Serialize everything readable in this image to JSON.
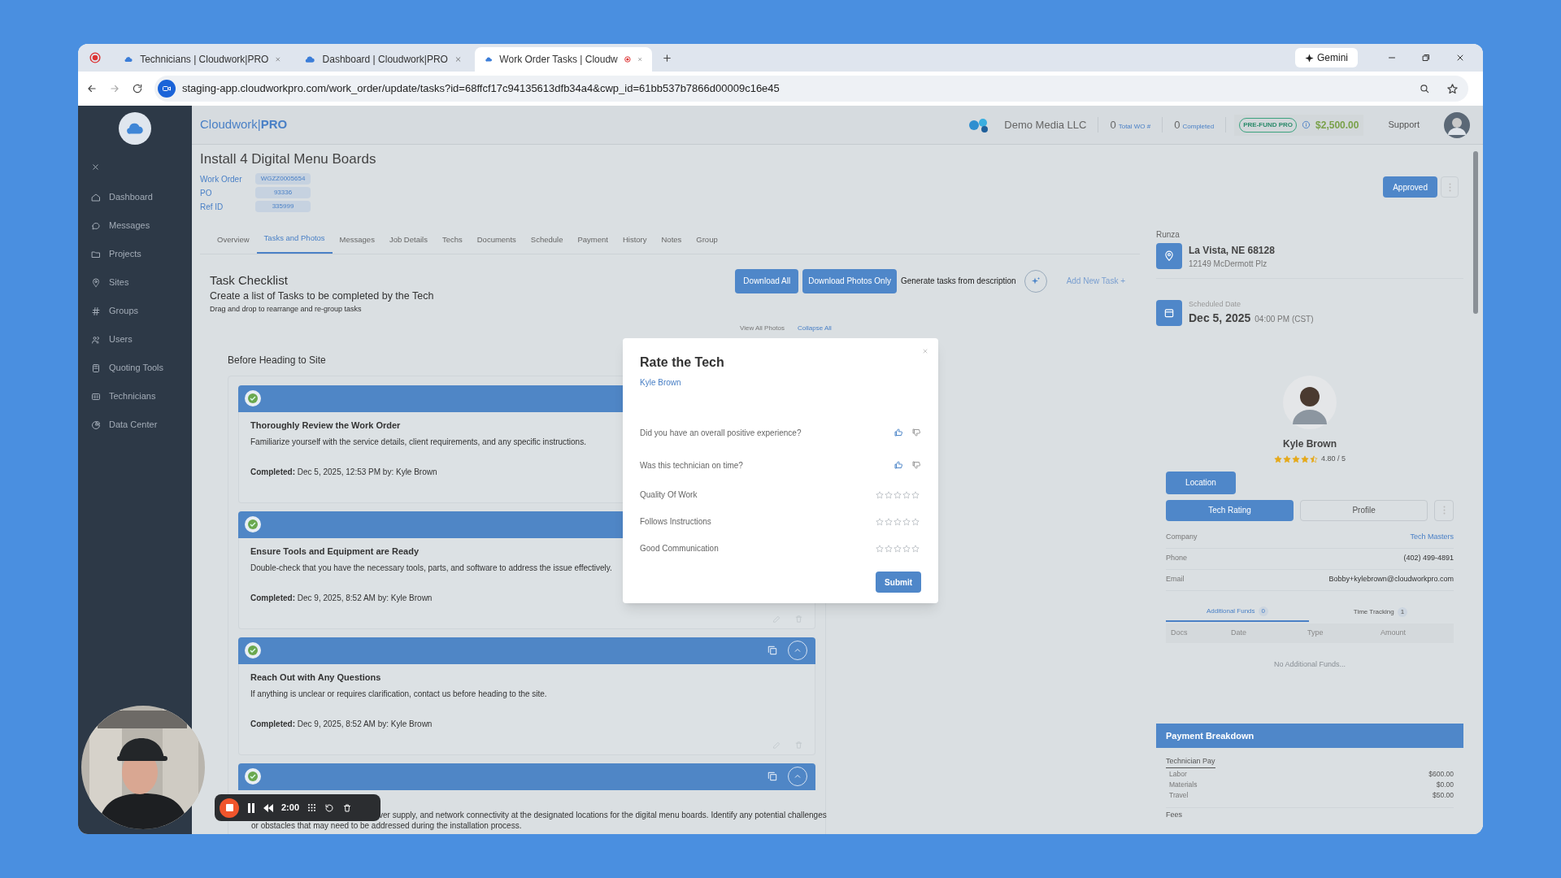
{
  "browser": {
    "tabs": [
      {
        "title": "Technicians | Cloudwork|PRO",
        "selected": false,
        "recording": false
      },
      {
        "title": "Dashboard | Cloudwork|PRO",
        "selected": false,
        "recording": false
      },
      {
        "title": "Work Order Tasks | Cloudw",
        "selected": true,
        "recording": true
      }
    ],
    "gemini": "Gemini",
    "url": "staging-app.cloudworkpro.com/work_order/update/tasks?id=68ffcf17c94135613dfb34a4&cwp_id=61bb537b7866d00009c16e45"
  },
  "sidebar": {
    "items": [
      "Dashboard",
      "Messages",
      "Projects",
      "Sites",
      "Groups",
      "Users",
      "Quoting Tools",
      "Technicians",
      "Data Center"
    ]
  },
  "header": {
    "brand": "Cloudwork|**PRO**",
    "company": "Demo Media LLC",
    "stats": [
      {
        "value": "0",
        "label": "Total WO #"
      },
      {
        "value": "0",
        "label": "Completed"
      }
    ],
    "badge": "PRE-FUND PRO",
    "balance": "$2,500.00",
    "support": "Support"
  },
  "work_order": {
    "title": "Install 4 Digital Menu Boards",
    "fields": [
      {
        "label": "Work Order",
        "value": "WGZZ0005654"
      },
      {
        "label": "PO",
        "value": "93336"
      },
      {
        "label": "Ref ID",
        "value": "335999"
      }
    ],
    "status": "Approved"
  },
  "tabs": [
    {
      "label": "Overview",
      "selected": false
    },
    {
      "label": "Tasks and Photos",
      "selected": true
    },
    {
      "label": "Messages",
      "selected": false
    },
    {
      "label": "Job Details",
      "selected": false
    },
    {
      "label": "Techs",
      "selected": false
    },
    {
      "label": "Documents",
      "selected": false
    },
    {
      "label": "Schedule",
      "selected": false
    },
    {
      "label": "Payment",
      "selected": false
    },
    {
      "label": "History",
      "selected": false
    },
    {
      "label": "Notes",
      "selected": false
    },
    {
      "label": "Group",
      "selected": false
    }
  ],
  "checklist": {
    "title": "Task Checklist",
    "subtitle": "Create a list of Tasks to be completed by the Tech",
    "hint": "Drag and drop to rearrange and re-group tasks",
    "actions": [
      "Download All",
      "Download Photos Only"
    ],
    "generate": "Generate tasks from description",
    "add": "Add New Task +",
    "links": [
      "View All Photos",
      "Collapse All"
    ],
    "group": "Before Heading to Site",
    "tasks": [
      {
        "kind": "full",
        "title": "Thoroughly Review the Work Order",
        "description": "Familiarize yourself with the service details, client requirements, and any specific instructions.",
        "completed_label": "Completed:",
        "completed": "Dec 5, 2025, 12:53 PM by: Kyle Brown"
      },
      {
        "kind": "full",
        "title": "Ensure Tools and Equipment are Ready",
        "description": "Double-check that you have the necessary tools, parts, and software to address the issue effectively.",
        "completed_label": "Completed:",
        "completed": "Dec 9, 2025, 8:52 AM by: Kyle Brown",
        "footer_tools": true
      },
      {
        "kind": "full",
        "title": "Reach Out with Any Questions",
        "description": "If anything is unclear or requires clarification, contact us before heading to the site.",
        "completed_label": "Completed:",
        "completed": "Dec 9, 2025, 8:52 AM by: Kyle Brown",
        "header_tools": true,
        "footer_tools": true
      },
      {
        "kind": "partial",
        "lines": [
          "ver supply, and network connectivity at the designated locations for the digital menu boards. Identify any potential challenges",
          "or obstacles that may need to be addressed during the installation process."
        ],
        "header_tools": true
      }
    ]
  },
  "modal": {
    "title": "Rate the Tech",
    "tech": "Kyle Brown",
    "questions": [
      {
        "kind": "thumbs",
        "label": "Did you have an overall positive experience?"
      },
      {
        "kind": "thumbs",
        "label": "Was this technician on time?"
      },
      {
        "kind": "stars",
        "label": "Quality Of Work",
        "stars": 0
      },
      {
        "kind": "stars",
        "label": "Follows Instructions",
        "stars": 0
      },
      {
        "kind": "stars",
        "label": "Good Communication",
        "stars": 0
      }
    ],
    "submit": "Submit"
  },
  "panel": {
    "site": "Runza",
    "city": "La Vista, NE 68128",
    "address": "12149 McDermott Plz",
    "schedule_label": "Scheduled Date",
    "date": "Dec 5, 2025",
    "time": "04:00 PM (CST)",
    "tech": {
      "name": "Kyle Brown",
      "stars": 4.5,
      "rating": "4.80 / 5"
    },
    "location_button": "Location",
    "tech_tabs": [
      {
        "label": "Tech Rating",
        "selected": true
      },
      {
        "label": "Profile",
        "selected": false
      }
    ],
    "details": [
      {
        "label": "Company",
        "value": "Tech Masters",
        "kind": "link"
      },
      {
        "label": "Phone",
        "value": "(402) 499-4891",
        "kind": "text"
      },
      {
        "label": "Email",
        "value": "Bobby+kylebrown@cloudworkpro.com",
        "kind": "text"
      }
    ],
    "funds_tabs": [
      {
        "label": "Additional Funds",
        "count": "0",
        "selected": true
      },
      {
        "label": "Time Tracking",
        "count": "1",
        "selected": false
      }
    ],
    "columns": [
      "Docs",
      "Date",
      "Type",
      "Amount"
    ],
    "empty": "No Additional Funds...",
    "payment": {
      "title": "Payment Breakdown",
      "section": "Technician Pay",
      "lines": [
        {
          "label": "Labor",
          "value": "$600.00"
        },
        {
          "label": "Materials",
          "value": "$0.00"
        },
        {
          "label": "Travel",
          "value": "$50.00"
        }
      ],
      "next": "Fees"
    }
  },
  "recorder": {
    "time": "2:00"
  }
}
